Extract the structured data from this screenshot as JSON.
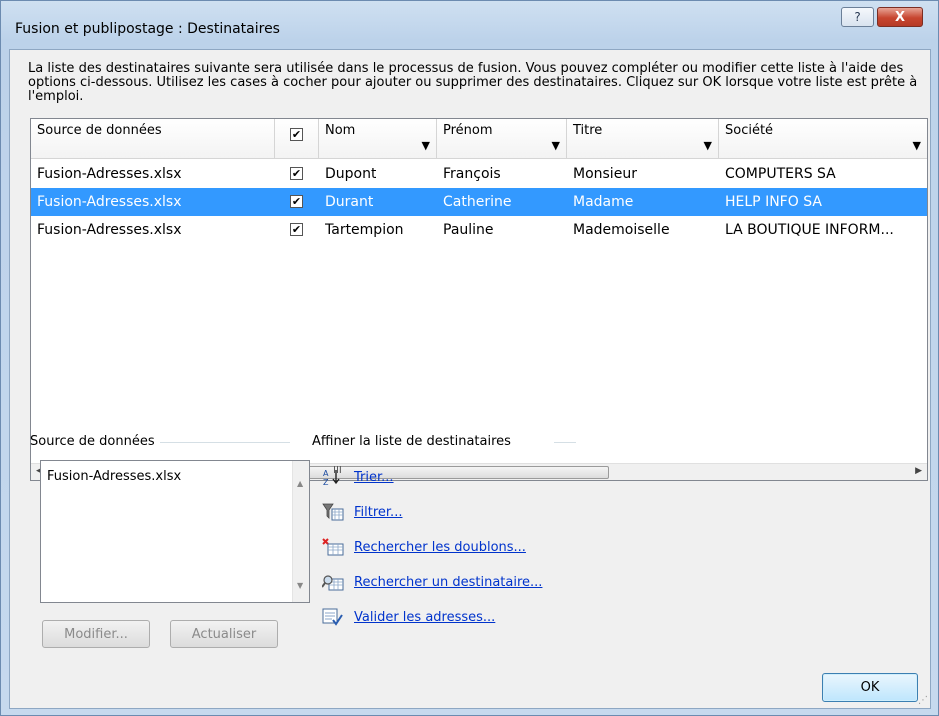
{
  "window": {
    "title": "Fusion et publipostage : Destinataires",
    "help_label": "?",
    "close_label": "X"
  },
  "intro_text": "La liste des destinataires suivante sera utilisée dans le processus de fusion. Vous pouvez compléter ou modifier cette liste à l'aide des options ci-dessous. Utilisez les cases à cocher pour ajouter ou supprimer des destinataires. Cliquez sur OK lorsque votre liste est prête à l'emploi.",
  "grid": {
    "columns": [
      "Source de données",
      "",
      "Nom",
      "Prénom",
      "Titre",
      "Société"
    ],
    "header_checked": true,
    "rows": [
      {
        "source": "Fusion-Adresses.xlsx",
        "checked": true,
        "nom": "Dupont",
        "prenom": "François",
        "titre": "Monsieur",
        "societe": "COMPUTERS SA",
        "selected": false
      },
      {
        "source": "Fusion-Adresses.xlsx",
        "checked": true,
        "nom": "Durant",
        "prenom": "Catherine",
        "titre": "Madame",
        "societe": "HELP INFO SA",
        "selected": true
      },
      {
        "source": "Fusion-Adresses.xlsx",
        "checked": true,
        "nom": "Tartempion",
        "prenom": "Pauline",
        "titre": "Mademoiselle",
        "societe": "LA BOUTIQUE INFORM...",
        "selected": false
      }
    ],
    "scroll_grip": "III",
    "selection_color": "#3399ff"
  },
  "source_section": {
    "label": "Source de données",
    "items": [
      "Fusion-Adresses.xlsx"
    ],
    "modify_label": "Modifier...",
    "refresh_label": "Actualiser"
  },
  "refine_section": {
    "label": "Affiner la liste de destinataires",
    "links": [
      {
        "label": "Trier...",
        "icon": "sort-az-icon"
      },
      {
        "label": "Filtrer...",
        "icon": "filter-icon"
      },
      {
        "label": "Rechercher les doublons...",
        "icon": "duplicates-icon"
      },
      {
        "label": "Rechercher un destinataire...",
        "icon": "find-recipient-icon"
      },
      {
        "label": "Valider les adresses...",
        "icon": "validate-addresses-icon"
      }
    ]
  },
  "ok_label": "OK"
}
